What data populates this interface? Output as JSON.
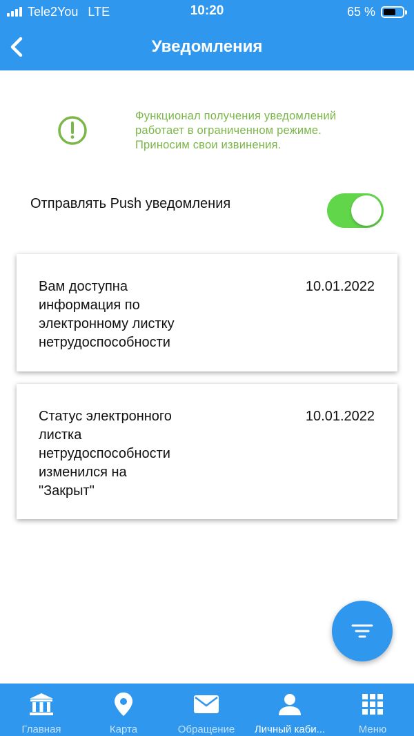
{
  "status_bar": {
    "carrier": "Tele2You",
    "network": "LTE",
    "time": "10:20",
    "battery_text": "65 %",
    "battery_level": 0.65
  },
  "nav": {
    "title": "Уведомления",
    "back_icon": "chevron-left-icon"
  },
  "warning": {
    "icon": "alert-circle-icon",
    "color": "#7ab648",
    "lines": [
      "Функционал получения уведомлений",
      "работает в ограниченном режиме.",
      "Приносим свои извинения."
    ]
  },
  "push": {
    "label": "Отправлять Push уведомления",
    "enabled": true,
    "toggle_color": "#62d64b"
  },
  "notifications": [
    {
      "lines": [
        "Вам доступна",
        "информация по",
        "электронному листку",
        "нетрудоспособности"
      ],
      "date": "10.01.2022"
    },
    {
      "lines": [
        "Статус электронного",
        "листка",
        "нетрудоспособности",
        "изменился на",
        "\"Закрыт\""
      ],
      "date": "10.01.2022"
    }
  ],
  "fab": {
    "icon": "filter-icon"
  },
  "tabs": [
    {
      "label": "Главная",
      "icon": "bank-icon",
      "active": false
    },
    {
      "label": "Карта",
      "icon": "map-pin-icon",
      "active": false
    },
    {
      "label": "Обращение",
      "icon": "mail-icon",
      "active": false
    },
    {
      "label": "Личный каби...",
      "icon": "user-icon",
      "active": true
    },
    {
      "label": "Меню",
      "icon": "grid-icon",
      "active": false
    }
  ],
  "colors": {
    "accent": "#2f97ee",
    "warning_text": "#7ab648",
    "toggle_on": "#62d64b"
  }
}
